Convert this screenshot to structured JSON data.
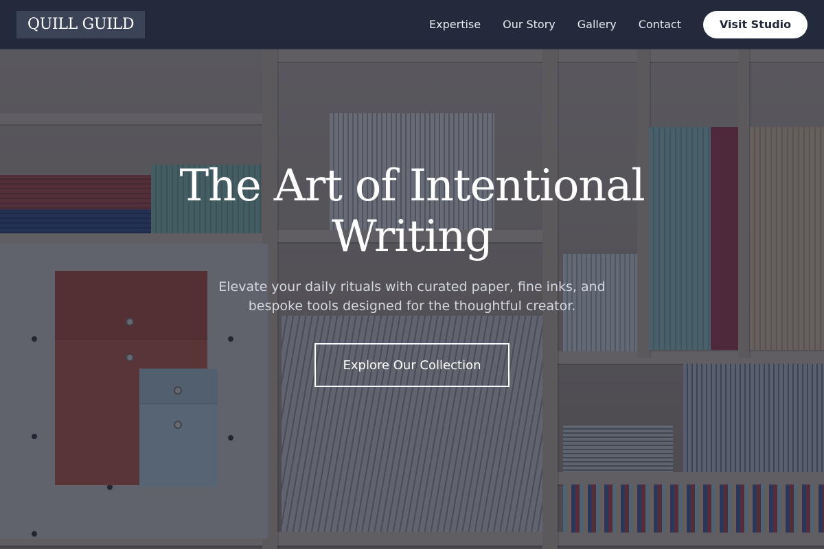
{
  "nav": {
    "logo": "QUILL GUILD",
    "links": [
      "Expertise",
      "Our Story",
      "Gallery",
      "Contact"
    ],
    "cta_label": "Visit Studio"
  },
  "hero": {
    "title": "The Art of Intentional Writing",
    "subtitle": "Elevate your daily rituals with curated paper, fine inks, and bespoke tools designed for the thoughtful creator.",
    "button_label": "Explore Our Collection"
  },
  "colors": {
    "navbar_bg": "#1e2638",
    "overlay": "#161e34",
    "cta_bg": "#ffffff",
    "cta_text": "#1e2638",
    "accent_red_folder": "#c4593f",
    "accent_blue_folder": "#bfd4da"
  }
}
